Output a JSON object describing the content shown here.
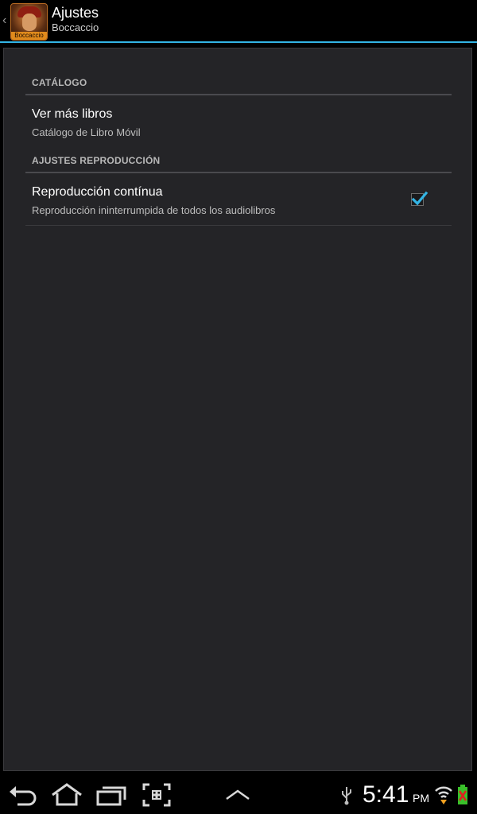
{
  "action_bar": {
    "up_caret": "‹",
    "icon_label": "Boccaccio",
    "title": "Ajustes",
    "subtitle": "Boccaccio"
  },
  "preferences": {
    "category_catalog": "CATÁLOGO",
    "more_books": {
      "title": "Ver más libros",
      "summary": "Catálogo de Libro Móvil"
    },
    "category_playback": "AJUSTES REPRODUCCIÓN",
    "continuous_playback": {
      "title": "Reproducción contínua",
      "summary": "Reproducción ininterrumpida de todos los audiolibros",
      "checked": true
    }
  },
  "system_bar": {
    "time": "5:41",
    "ampm": "PM",
    "icons": [
      "back-icon",
      "home-icon",
      "recent-apps-icon",
      "screenshot-icon",
      "menu-up-icon",
      "usb-icon",
      "wifi-icon",
      "battery-icon"
    ]
  },
  "colors": {
    "accent": "#33b5e5",
    "panel_bg": "#242427",
    "battery_red": "#e02020",
    "battery_green": "#39c02a"
  }
}
